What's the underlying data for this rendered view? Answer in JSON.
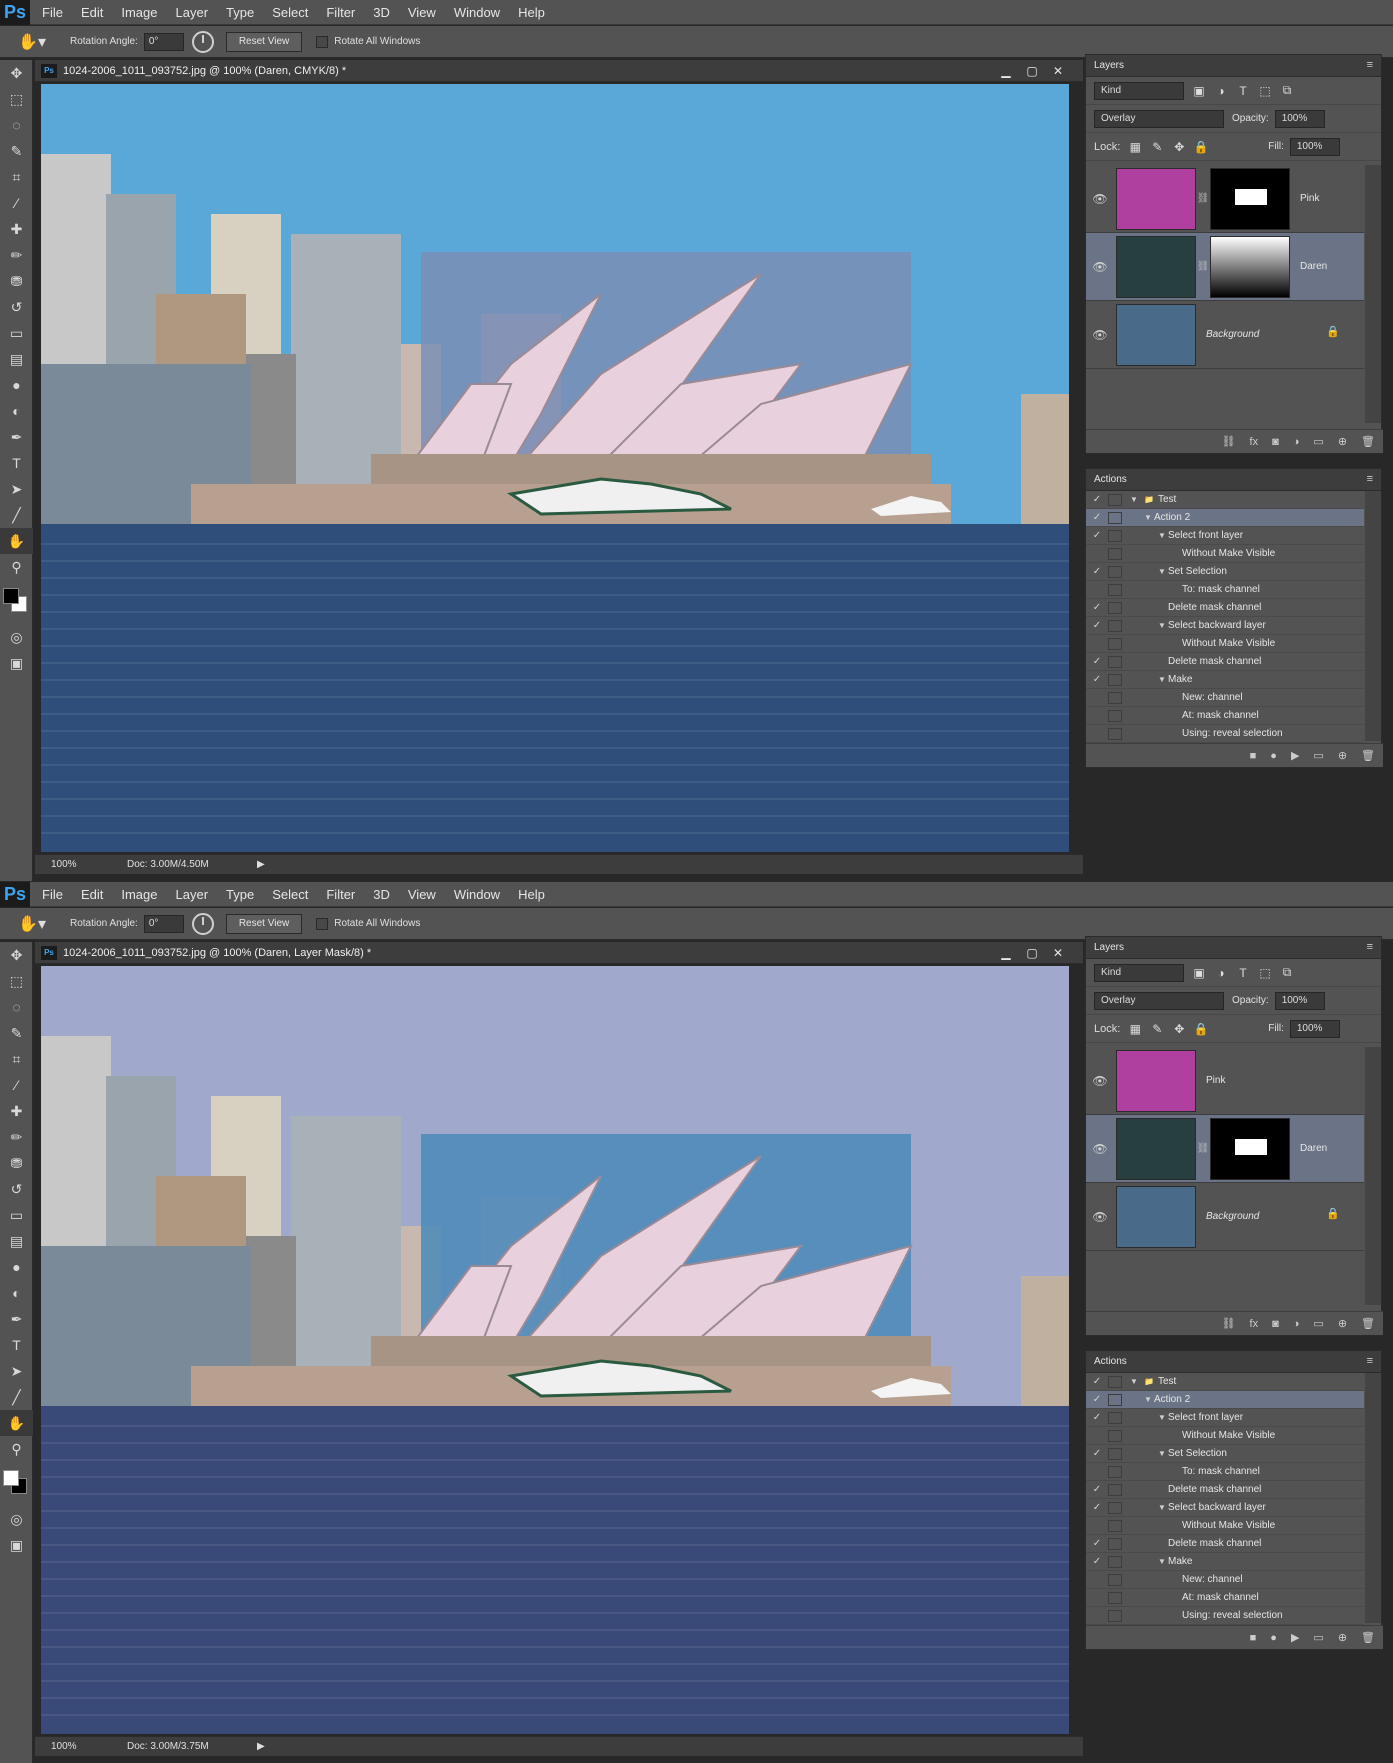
{
  "app": {
    "logo": "Ps",
    "menu": [
      "File",
      "Edit",
      "Image",
      "Layer",
      "Type",
      "Select",
      "Filter",
      "3D",
      "View",
      "Window",
      "Help"
    ]
  },
  "options": {
    "rotation_label": "Rotation Angle:",
    "rotation_value": "0°",
    "reset_button": "Reset View",
    "rotate_all_label": "Rotate All Windows"
  },
  "instances": [
    {
      "doc_title": "1024-2006_1011_093752.jpg @ 100% (Daren, CMYK/8) *",
      "zoom": "100%",
      "doc_size": "Doc: 3.00M/4.50M",
      "fg_color": "#000000",
      "bg_color": "#ffffff",
      "sky_color": "#5aa8d8",
      "water_color": "#2f4f7a",
      "box_color": "#7a8fb5",
      "opera_color": "#e8d0dc",
      "layers": {
        "panel_title": "Layers",
        "kind_label": "Kind",
        "blend_mode": "Overlay",
        "opacity_label": "Opacity:",
        "opacity_value": "100%",
        "lock_label": "Lock:",
        "fill_label": "Fill:",
        "fill_value": "100%",
        "rows": [
          {
            "name": "Pink",
            "italic": false,
            "selected": false,
            "thumb_color": "#b040a0",
            "mask": true,
            "mask_type": "white-rect"
          },
          {
            "name": "Daren",
            "italic": false,
            "selected": true,
            "thumb_color": "#27403f",
            "mask": true,
            "mask_type": "gradient"
          },
          {
            "name": "Background",
            "italic": true,
            "selected": false,
            "thumb_color": "#4a6a8a",
            "mask": false,
            "mask_type": "none"
          }
        ]
      },
      "actions": {
        "panel_title": "Actions",
        "rows": [
          {
            "text": "Test",
            "indent": 0,
            "checked": true,
            "tri": "down",
            "folder": true,
            "selected": false
          },
          {
            "text": "Action 2",
            "indent": 1,
            "checked": true,
            "tri": "down",
            "folder": false,
            "selected": true
          },
          {
            "text": "Select front layer",
            "indent": 2,
            "checked": true,
            "tri": "down",
            "folder": false,
            "selected": false
          },
          {
            "text": "Without Make Visible",
            "indent": 3,
            "checked": false,
            "tri": "",
            "folder": false,
            "selected": false
          },
          {
            "text": "Set Selection",
            "indent": 2,
            "checked": true,
            "tri": "down",
            "folder": false,
            "selected": false
          },
          {
            "text": "To: mask channel",
            "indent": 3,
            "checked": false,
            "tri": "",
            "folder": false,
            "selected": false
          },
          {
            "text": "Delete mask channel",
            "indent": 2,
            "checked": true,
            "tri": "",
            "folder": false,
            "selected": false
          },
          {
            "text": "Select backward layer",
            "indent": 2,
            "checked": true,
            "tri": "down",
            "folder": false,
            "selected": false
          },
          {
            "text": "Without Make Visible",
            "indent": 3,
            "checked": false,
            "tri": "",
            "folder": false,
            "selected": false
          },
          {
            "text": "Delete mask channel",
            "indent": 2,
            "checked": true,
            "tri": "",
            "folder": false,
            "selected": false
          },
          {
            "text": "Make",
            "indent": 2,
            "checked": true,
            "tri": "down",
            "folder": false,
            "selected": false
          },
          {
            "text": "New: channel",
            "indent": 3,
            "checked": false,
            "tri": "",
            "folder": false,
            "selected": false
          },
          {
            "text": "At: mask channel",
            "indent": 3,
            "checked": false,
            "tri": "",
            "folder": false,
            "selected": false
          },
          {
            "text": "Using: reveal selection",
            "indent": 3,
            "checked": false,
            "tri": "",
            "folder": false,
            "selected": false
          }
        ]
      }
    },
    {
      "doc_title": "1024-2006_1011_093752.jpg @ 100% (Daren, Layer Mask/8) *",
      "zoom": "100%",
      "doc_size": "Doc: 3.00M/3.75M",
      "fg_color": "#ffffff",
      "bg_color": "#000000",
      "sky_color": "#a0a8cc",
      "water_color": "#3a4a78",
      "box_color": "#4a8ab8",
      "opera_color": "#e8d0dc",
      "layers": {
        "panel_title": "Layers",
        "kind_label": "Kind",
        "blend_mode": "Overlay",
        "opacity_label": "Opacity:",
        "opacity_value": "100%",
        "lock_label": "Lock:",
        "fill_label": "Fill:",
        "fill_value": "100%",
        "rows": [
          {
            "name": "Pink",
            "italic": false,
            "selected": false,
            "thumb_color": "#b040a0",
            "mask": false,
            "mask_type": "none"
          },
          {
            "name": "Daren",
            "italic": false,
            "selected": true,
            "thumb_color": "#27403f",
            "mask": true,
            "mask_type": "white-rect"
          },
          {
            "name": "Background",
            "italic": true,
            "selected": false,
            "thumb_color": "#4a6a8a",
            "mask": false,
            "mask_type": "none"
          }
        ]
      },
      "actions": {
        "panel_title": "Actions",
        "rows": [
          {
            "text": "Test",
            "indent": 0,
            "checked": true,
            "tri": "down",
            "folder": true,
            "selected": false
          },
          {
            "text": "Action 2",
            "indent": 1,
            "checked": true,
            "tri": "down",
            "folder": false,
            "selected": true
          },
          {
            "text": "Select front layer",
            "indent": 2,
            "checked": true,
            "tri": "down",
            "folder": false,
            "selected": false
          },
          {
            "text": "Without Make Visible",
            "indent": 3,
            "checked": false,
            "tri": "",
            "folder": false,
            "selected": false
          },
          {
            "text": "Set Selection",
            "indent": 2,
            "checked": true,
            "tri": "down",
            "folder": false,
            "selected": false
          },
          {
            "text": "To: mask channel",
            "indent": 3,
            "checked": false,
            "tri": "",
            "folder": false,
            "selected": false
          },
          {
            "text": "Delete mask channel",
            "indent": 2,
            "checked": true,
            "tri": "",
            "folder": false,
            "selected": false
          },
          {
            "text": "Select backward layer",
            "indent": 2,
            "checked": true,
            "tri": "down",
            "folder": false,
            "selected": false
          },
          {
            "text": "Without Make Visible",
            "indent": 3,
            "checked": false,
            "tri": "",
            "folder": false,
            "selected": false
          },
          {
            "text": "Delete mask channel",
            "indent": 2,
            "checked": true,
            "tri": "",
            "folder": false,
            "selected": false
          },
          {
            "text": "Make",
            "indent": 2,
            "checked": true,
            "tri": "down",
            "folder": false,
            "selected": false
          },
          {
            "text": "New: channel",
            "indent": 3,
            "checked": false,
            "tri": "",
            "folder": false,
            "selected": false
          },
          {
            "text": "At: mask channel",
            "indent": 3,
            "checked": false,
            "tri": "",
            "folder": false,
            "selected": false
          },
          {
            "text": "Using: reveal selection",
            "indent": 3,
            "checked": false,
            "tri": "",
            "folder": false,
            "selected": false
          }
        ]
      }
    }
  ],
  "tools": [
    {
      "icon": "move-tool-icon",
      "glyph": "✥"
    },
    {
      "icon": "marquee-tool-icon",
      "glyph": "⬚"
    },
    {
      "icon": "lasso-tool-icon",
      "glyph": "◌"
    },
    {
      "icon": "quick-select-tool-icon",
      "glyph": "✎"
    },
    {
      "icon": "crop-tool-icon",
      "glyph": "⌗"
    },
    {
      "icon": "eyedropper-tool-icon",
      "glyph": "⁄"
    },
    {
      "icon": "healing-brush-tool-icon",
      "glyph": "✚"
    },
    {
      "icon": "brush-tool-icon",
      "glyph": "✏"
    },
    {
      "icon": "clone-stamp-tool-icon",
      "glyph": "⛃"
    },
    {
      "icon": "history-brush-tool-icon",
      "glyph": "↺"
    },
    {
      "icon": "eraser-tool-icon",
      "glyph": "▭"
    },
    {
      "icon": "gradient-tool-icon",
      "glyph": "▤"
    },
    {
      "icon": "blur-tool-icon",
      "glyph": "●"
    },
    {
      "icon": "dodge-tool-icon",
      "glyph": "◐"
    },
    {
      "icon": "pen-tool-icon",
      "glyph": "✒"
    },
    {
      "icon": "type-tool-icon",
      "glyph": "T"
    },
    {
      "icon": "path-select-tool-icon",
      "glyph": "➤"
    },
    {
      "icon": "line-tool-icon",
      "glyph": "╱"
    },
    {
      "icon": "rotate-view-tool-icon",
      "glyph": "✋",
      "active": true
    },
    {
      "icon": "zoom-tool-icon",
      "glyph": "⚲"
    }
  ]
}
